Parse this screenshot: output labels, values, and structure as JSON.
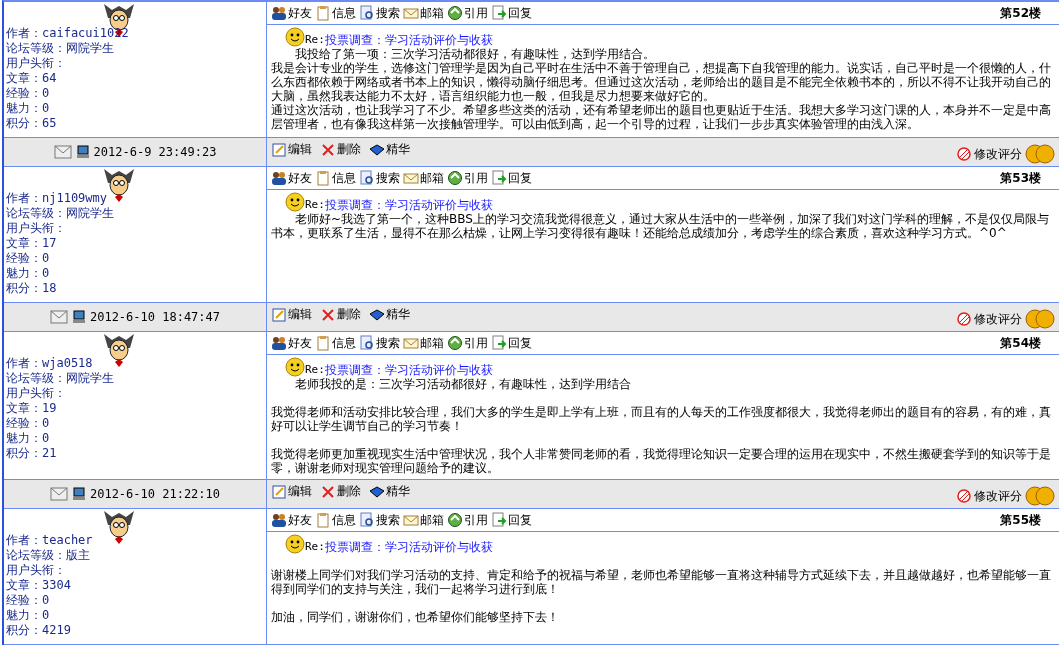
{
  "posts": [
    {
      "author_lines": [
        "作者：caifacui1022",
        "论坛等级：网院学生",
        "用户头衔：",
        "文章：64",
        "经验：0",
        "魅力：0",
        "积分：65"
      ],
      "toolbar": [
        "好友",
        "信息",
        "搜索",
        "邮箱",
        "引用",
        "回复"
      ],
      "floor": "第52楼",
      "title_prefix": "Re:",
      "title": "投票调查：学习活动评价与收获",
      "paragraphs": [
        {
          "text": "我投给了第一项：三次学习活动都很好，有趣味性，达到学用结合。",
          "indent": true,
          "spaced": false
        },
        {
          "text": "我是会计专业的学生，选修这门管理学是因为自己平时在生活中不善于管理自己，想提高下自我管理的能力。说实话，自己平时是一个很懒的人，什么东西都依赖于网络或者书本上的知识，懒得动脑仔细思考。但通过这次活动，老师给出的题目是不能完全依赖书本的，所以不得不让我开动自己的大脑，虽然我表达能力不太好，语言组织能力也一般，但我是尽力想要来做好它的。",
          "indent": false,
          "spaced": false
        },
        {
          "text": "通过这次活动，也让我学习了不少。希望多些这类的活动，还有希望老师出的题目也更贴近于生活。我想大多学习这门课的人，本身并不一定是中高层管理者，也有像我这样第一次接触管理学。可以由低到高，起一个引导的过程，让我们一步步真实体验管理的由浅入深。",
          "indent": false,
          "spaced": false
        }
      ],
      "footer": {
        "date": "2012-6-9 23:49:23",
        "actions": [
          "编辑",
          "删除",
          "精华"
        ],
        "rating": "修改评分"
      }
    },
    {
      "author_lines": [
        "作者：nj1109wmy",
        "论坛等级：网院学生",
        "用户头衔：",
        "文章：17",
        "经验：0",
        "魅力：0",
        "积分：18"
      ],
      "toolbar": [
        "好友",
        "信息",
        "搜索",
        "邮箱",
        "引用",
        "回复"
      ],
      "floor": "第53楼",
      "title_prefix": "Re:",
      "title": "投票调查：学习活动评价与收获",
      "paragraphs": [
        {
          "text": "老师好~我选了第一个，这种BBS上的学习交流我觉得很意义，通过大家从生活中的一些举例，加深了我们对这门学科的理解，不是仅仅局限与书本，更联系了生活，显得不在那么枯燥，让网上学习变得很有趣味！还能给总成绩加分，考虑学生的综合素质，喜欢这种学习方式。^0^",
          "indent": true,
          "spaced": false
        }
      ],
      "footer": {
        "date": "2012-6-10 18:47:47",
        "actions": [
          "编辑",
          "删除",
          "精华"
        ],
        "rating": "修改评分"
      }
    },
    {
      "author_lines": [
        "作者：wja0518",
        "论坛等级：网院学生",
        "用户头衔：",
        "文章：19",
        "经验：0",
        "魅力：0",
        "积分：21"
      ],
      "toolbar": [
        "好友",
        "信息",
        "搜索",
        "邮箱",
        "引用",
        "回复"
      ],
      "floor": "第54楼",
      "title_prefix": "Re:",
      "title": "投票调查：学习活动评价与收获",
      "paragraphs": [
        {
          "text": "老师我投的是：三次学习活动都很好，有趣味性，达到学用结合",
          "indent": true,
          "spaced": false
        },
        {
          "text": "我觉得老师和活动安排比较合理，我们大多的学生是即上学有上班，而且有的人每天的工作强度都很大，我觉得老师出的题目有的容易，有的难，真好可以让学生调节自己的学习节奏！",
          "indent": false,
          "spaced": true
        },
        {
          "text": "我觉得老师更加重视现实生活中管理状况，我个人非常赞同老师的看，我觉得理论知识一定要合理的运用在现实中，不然生搬硬套学到的知识等于是零，谢谢老师对现实管理问题给予的建议。",
          "indent": false,
          "spaced": true
        }
      ],
      "footer": {
        "date": "2012-6-10 21:22:10",
        "actions": [
          "编辑",
          "删除",
          "精华"
        ],
        "rating": "修改评分"
      }
    },
    {
      "author_lines": [
        "作者：teacher",
        "论坛等级：版主",
        "用户头衔：",
        "文章：3304",
        "经验：0",
        "魅力：0",
        "积分：4219"
      ],
      "toolbar": [
        "好友",
        "信息",
        "搜索",
        "邮箱",
        "引用",
        "回复"
      ],
      "floor": "第55楼",
      "title_prefix": "Re:",
      "title": "投票调查：学习活动评价与收获",
      "paragraphs": [
        {
          "text": "谢谢楼上同学们对我们学习活动的支持、肯定和给予的祝福与希望，老师也希望能够一直将这种辅导方式延续下去，并且越做越好，也希望能够一直得到同学们的支持与关注，我们一起将学习进行到底！",
          "indent": false,
          "spaced": true
        },
        {
          "text": "加油，同学们，谢谢你们，也希望你们能够坚持下去！",
          "indent": false,
          "spaced": true
        }
      ]
    }
  ]
}
